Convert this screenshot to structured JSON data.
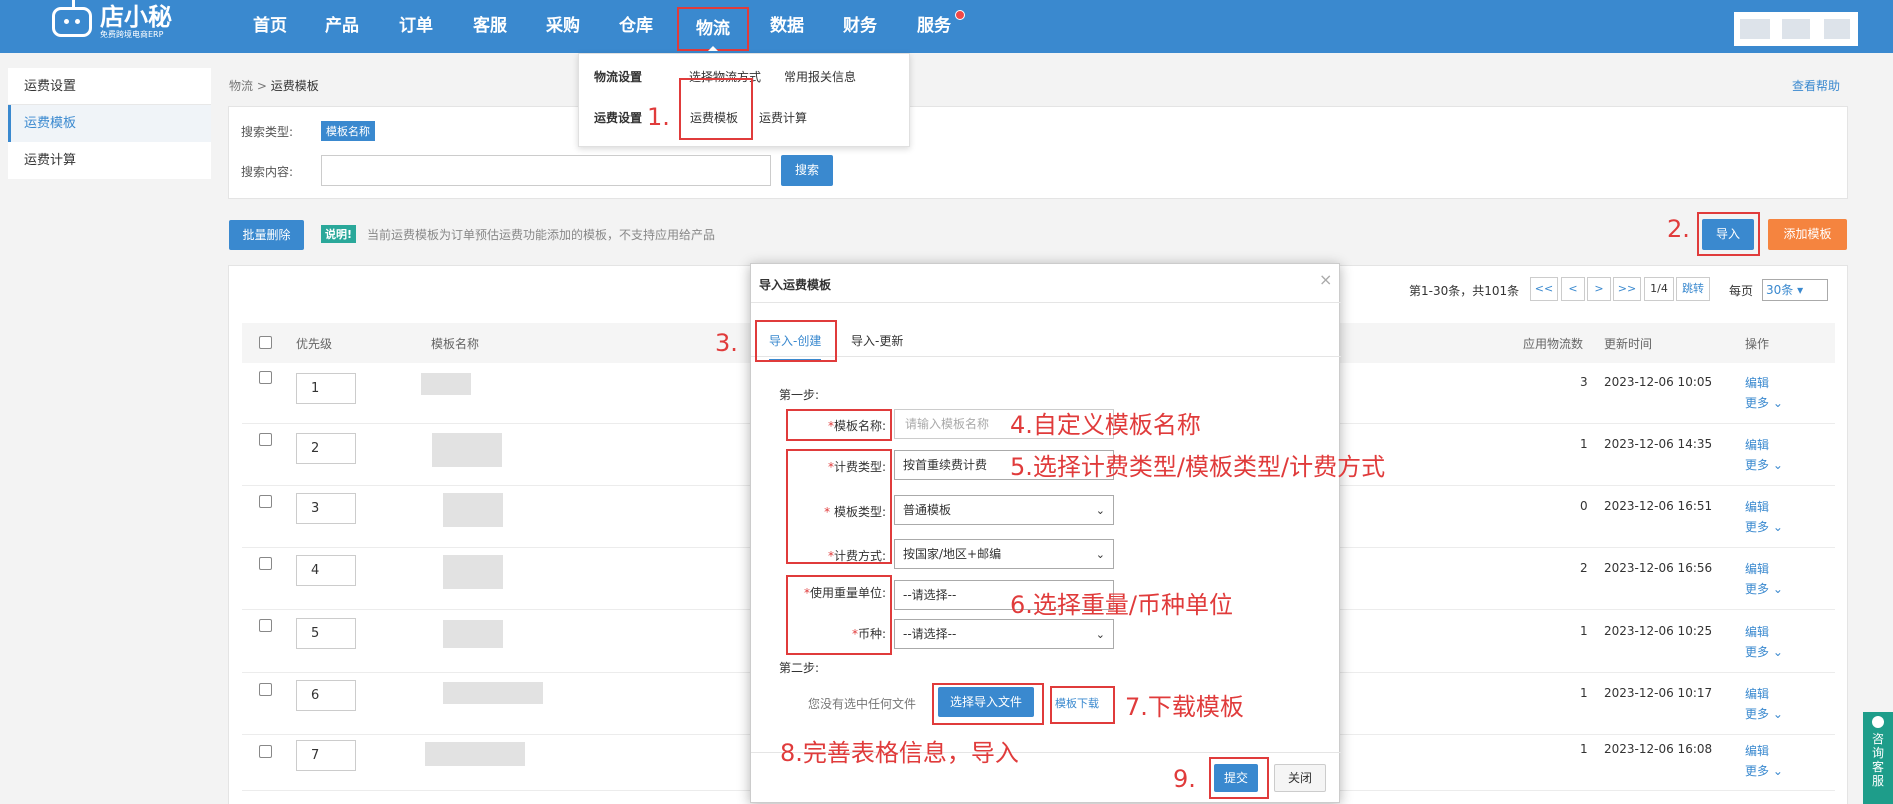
{
  "brand": {
    "name": "店小秘",
    "tagline": "免费跨境电商ERP"
  },
  "nav": [
    "首页",
    "产品",
    "订单",
    "客服",
    "采购",
    "仓库",
    "物流",
    "数据",
    "财务",
    "服务"
  ],
  "dropdown": {
    "group1_title": "物流设置",
    "group1_links": [
      "选择物流方式",
      "常用报关信息"
    ],
    "group2_title": "运费设置",
    "group2_links": [
      "运费模板",
      "运费计算"
    ]
  },
  "sidebar": {
    "header": "运费设置",
    "items": [
      "运费模板",
      "运费计算"
    ]
  },
  "breadcrumb": {
    "parent": "物流",
    "sep": " > ",
    "current": "运费模板"
  },
  "help_link": "查看帮助",
  "search": {
    "type_label": "搜索类型:",
    "type_tag": "模板名称",
    "content_label": "搜索内容:",
    "button": "搜索"
  },
  "toolbar": {
    "batch_delete": "批量删除",
    "note_tag": "说明!",
    "note_text": "当前运费模板为订单预估运费功能添加的模板，不支持应用给产品",
    "import": "导入",
    "add_template": "添加模板"
  },
  "pager": {
    "info": "第1-30条，共101条",
    "buttons": [
      "<<",
      "<",
      ">",
      ">>",
      "1/4",
      "跳转"
    ],
    "per_page_label": "每页",
    "per_page_value": "30条"
  },
  "table": {
    "headers": [
      "优先级",
      "模板名称",
      "应用物流数",
      "更新时间",
      "操作"
    ],
    "rows": [
      {
        "priority": "1",
        "count": "3",
        "time": "2023-12-06 10:05"
      },
      {
        "priority": "2",
        "count": "1",
        "time": "2023-12-06 14:35"
      },
      {
        "priority": "3",
        "count": "0",
        "time": "2023-12-06 16:51"
      },
      {
        "priority": "4",
        "count": "2",
        "time": "2023-12-06 16:56"
      },
      {
        "priority": "5",
        "count": "1",
        "time": "2023-12-06 10:25"
      },
      {
        "priority": "6",
        "count": "1",
        "time": "2023-12-06 10:17"
      },
      {
        "priority": "7",
        "count": "1",
        "time": "2023-12-06 16:08"
      }
    ],
    "edit": "编辑",
    "more": "更多"
  },
  "modal": {
    "title": "导入运费模板",
    "tabs": [
      "导入-创建",
      "导入-更新"
    ],
    "step1": "第一步:",
    "step2": "第二步:",
    "name_label": "模板名称:",
    "name_placeholder": "请输入模板名称",
    "billing_type_label": "计费类型:",
    "billing_type_value": "按首重续费计费",
    "template_type_label": "模板类型:",
    "template_type_value": "普通模板",
    "billing_method_label": "计费方式:",
    "billing_method_value": "按国家/地区+邮编",
    "weight_unit_label": "使用重量单位:",
    "weight_unit_value": "--请选择--",
    "currency_label": "币种:",
    "currency_value": "--请选择--",
    "no_file_text": "您没有选中任何文件",
    "choose_file": "选择导入文件",
    "download_template": "模板下载",
    "submit": "提交",
    "close": "关闭"
  },
  "annotations": {
    "a1": "1.",
    "a2": "2.",
    "a3": "3.",
    "a4": "4.自定义模板名称",
    "a5": "5.选择计费类型/模板类型/计费方式",
    "a6": "6.选择重量/币种单位",
    "a7": "7.下载模板",
    "a8": "8.完善表格信息，导入",
    "a9": "9."
  },
  "consult": "咨询客服",
  "colors": {
    "primary": "#3a89cf",
    "orange": "#f5843f",
    "annotation": "#e03b3b",
    "teal": "#2aa89a"
  }
}
